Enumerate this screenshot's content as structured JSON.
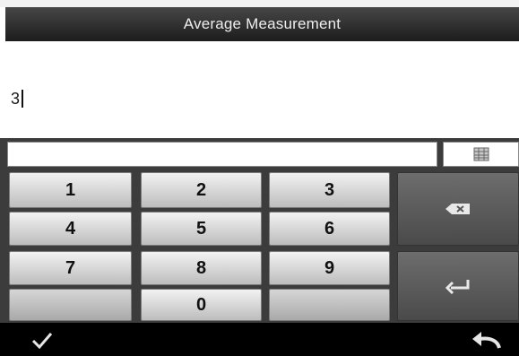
{
  "header": {
    "title": "Average Measurement"
  },
  "input": {
    "value": "3"
  },
  "keypad": {
    "row1": [
      "1",
      "2",
      "3"
    ],
    "row2": [
      "4",
      "5",
      "6"
    ],
    "row3": [
      "7",
      "8",
      "9"
    ],
    "row4": [
      "",
      "0",
      ""
    ]
  },
  "icons": {
    "grid": "grid-icon",
    "backspace": "backspace-icon",
    "enter": "enter-icon",
    "confirm": "checkmark-icon",
    "back": "back-arrow-icon"
  }
}
